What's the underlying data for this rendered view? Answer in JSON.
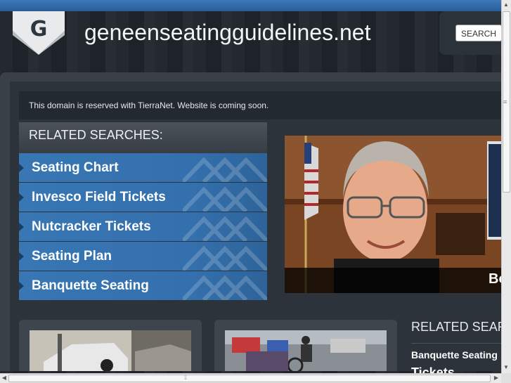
{
  "header": {
    "logo_letter": "G",
    "site_title": "geneenseatingguidelines.net",
    "search_label": "SEARCH"
  },
  "notice": "This domain is reserved with TierraNet. Website is coming soon.",
  "related_searches": {
    "title": "RELATED SEARCHES:",
    "items": [
      {
        "label": "Seating Chart"
      },
      {
        "label": "Invesco Field Tickets"
      },
      {
        "label": "Nutcracker Tickets"
      },
      {
        "label": "Seating Plan"
      },
      {
        "label": "Banquette Seating"
      }
    ]
  },
  "hero": {
    "caption": "Bo"
  },
  "related_searches_2": {
    "title": "RELATED SEAR",
    "items": [
      {
        "label": "Banquette Seating"
      },
      {
        "label": "Tickets"
      }
    ]
  },
  "colors": {
    "accent_blue": "#3470ad",
    "top_bar": "#3d78b8",
    "panel": "#3a4149"
  },
  "icons": {
    "logo": "shield-g-icon",
    "list_bullet": "triangle-right-icon"
  }
}
